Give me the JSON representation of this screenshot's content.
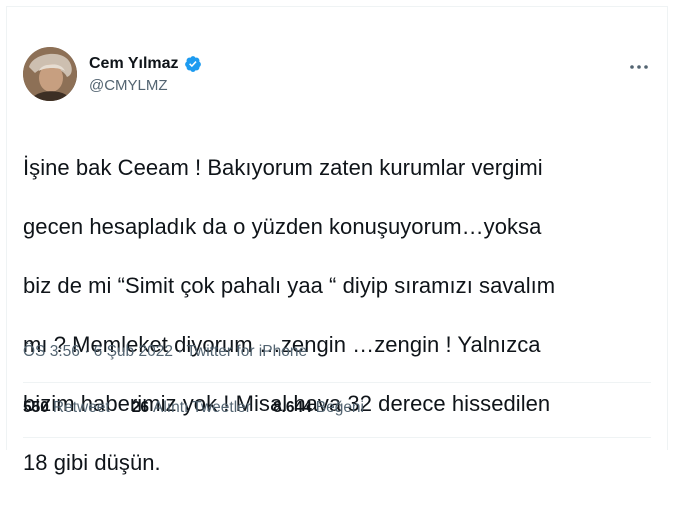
{
  "author": {
    "display_name": "Cem Yılmaz",
    "handle": "@CMYLMZ",
    "verified_icon": "verified-badge-icon",
    "avatar_icon": "profile-photo"
  },
  "tweet": {
    "lines": [
      "İşine bak Ceeam ! Bakıyorum zaten kurumlar vergimi",
      "gecen hesapladık da o yüzden konuşuyorum…yoksa",
      "biz de mi “Simit çok pahalı yaa “ diyip sıramızı savalım",
      "mı ? Memleket diyorum …zengin …zengin ! Yalnızca",
      "bizim haberimiz yok ! Misal hava 32 derece hissedilen",
      "18 gibi düşün."
    ]
  },
  "meta": {
    "time": "ÖS 3:56",
    "separator1": " · ",
    "date": "6 Şub 2022",
    "separator2": " · ",
    "source": "Twitter for iPhone"
  },
  "stats": {
    "retweets_count": "550",
    "retweets_label": "Retweet",
    "quotes_count": "26",
    "quotes_label": "Alıntı Tweetler",
    "likes_count": "8.644",
    "likes_label": "Beğeni"
  },
  "colors": {
    "text": "#0f1419",
    "secondary": "#536471",
    "verified": "#1d9bf0",
    "divider": "#eff3f4"
  }
}
